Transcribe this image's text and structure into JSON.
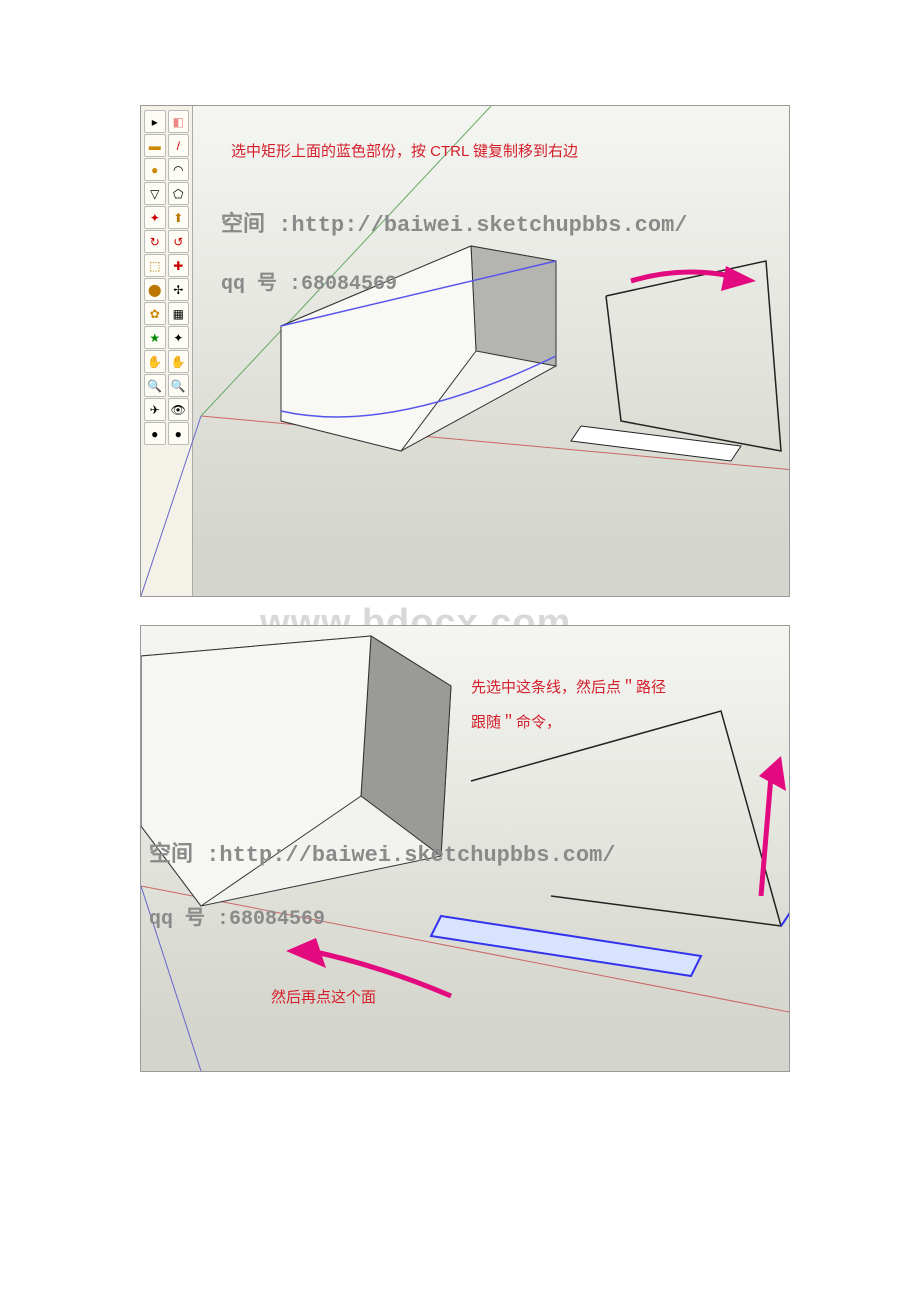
{
  "watermark": "www.bdocx.com",
  "panel1": {
    "note": "选中矩形上面的蓝色部份，按 CTRL 键复制移到右边",
    "url_label": "空间 :http://baiwei.sketchupbbs.com/",
    "qq_label": "qq 号 :68084569"
  },
  "panel2": {
    "note1": "先选中这条线，然后点＂路径",
    "note2": "跟随＂命令，",
    "note3": "然后再点这个面",
    "url_label": "空间 :http://baiwei.sketchupbbs.com/",
    "qq_label": "qq 号 :68084569"
  },
  "tool_icons": [
    "✎",
    "◧",
    "□",
    "/",
    "●",
    "◠",
    "▽",
    "⬠",
    "✦",
    "⬆",
    "↻",
    "↺",
    "⬚",
    "✚",
    "⬤",
    "✢",
    "✿",
    "▦",
    "★",
    "✦",
    "✋",
    "✋",
    "🔍",
    "🔍",
    "✈",
    "👁",
    "●",
    "●"
  ]
}
